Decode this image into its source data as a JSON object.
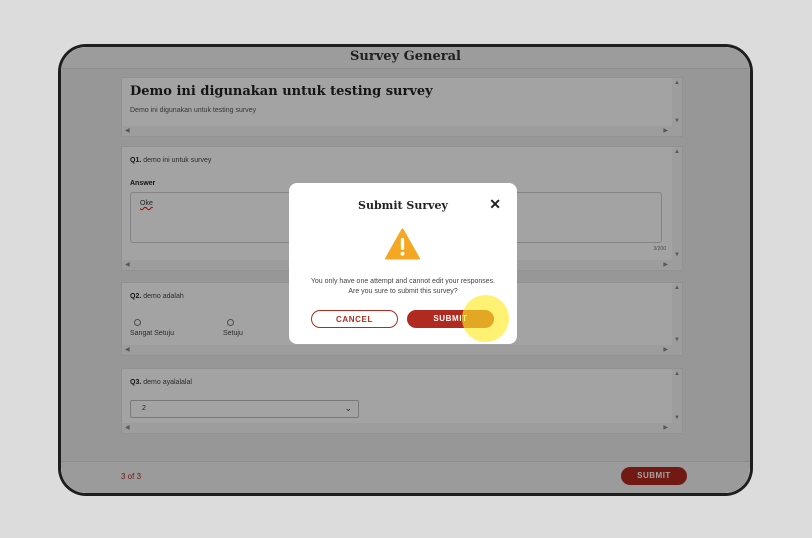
{
  "app": {
    "header_title": "Survey General"
  },
  "survey": {
    "title": "Demo ini digunakan untuk testing survey",
    "description": "Demo ini digunakan untuk testing survey"
  },
  "q1": {
    "number": "Q1.",
    "text": "demo ini untuk survey",
    "answer_label": "Answer",
    "answer_value": "Oke",
    "counter": "3/200"
  },
  "q2": {
    "number": "Q2.",
    "text": "demo adalah",
    "options": [
      "Sangat Setuju",
      "Setuju"
    ]
  },
  "q3": {
    "number": "Q3.",
    "text": "demo ayalalalal",
    "selected": "2"
  },
  "footer": {
    "pager": "3 of 3",
    "submit_label": "SUBMIT"
  },
  "modal": {
    "title": "Submit Survey",
    "close_symbol": "✕",
    "message": "You only have one attempt and cannot edit your responses. Are you sure to submit this survey?",
    "cancel_label": "CANCEL",
    "submit_label": "SUBMIT"
  },
  "icons": {
    "close": "close-icon",
    "warning": "warning-icon",
    "chevron": "chevron-down-icon"
  },
  "colors": {
    "brand": "#b12a1f",
    "warning": "#f5a623",
    "cursor_highlight": "#ffeb28"
  }
}
